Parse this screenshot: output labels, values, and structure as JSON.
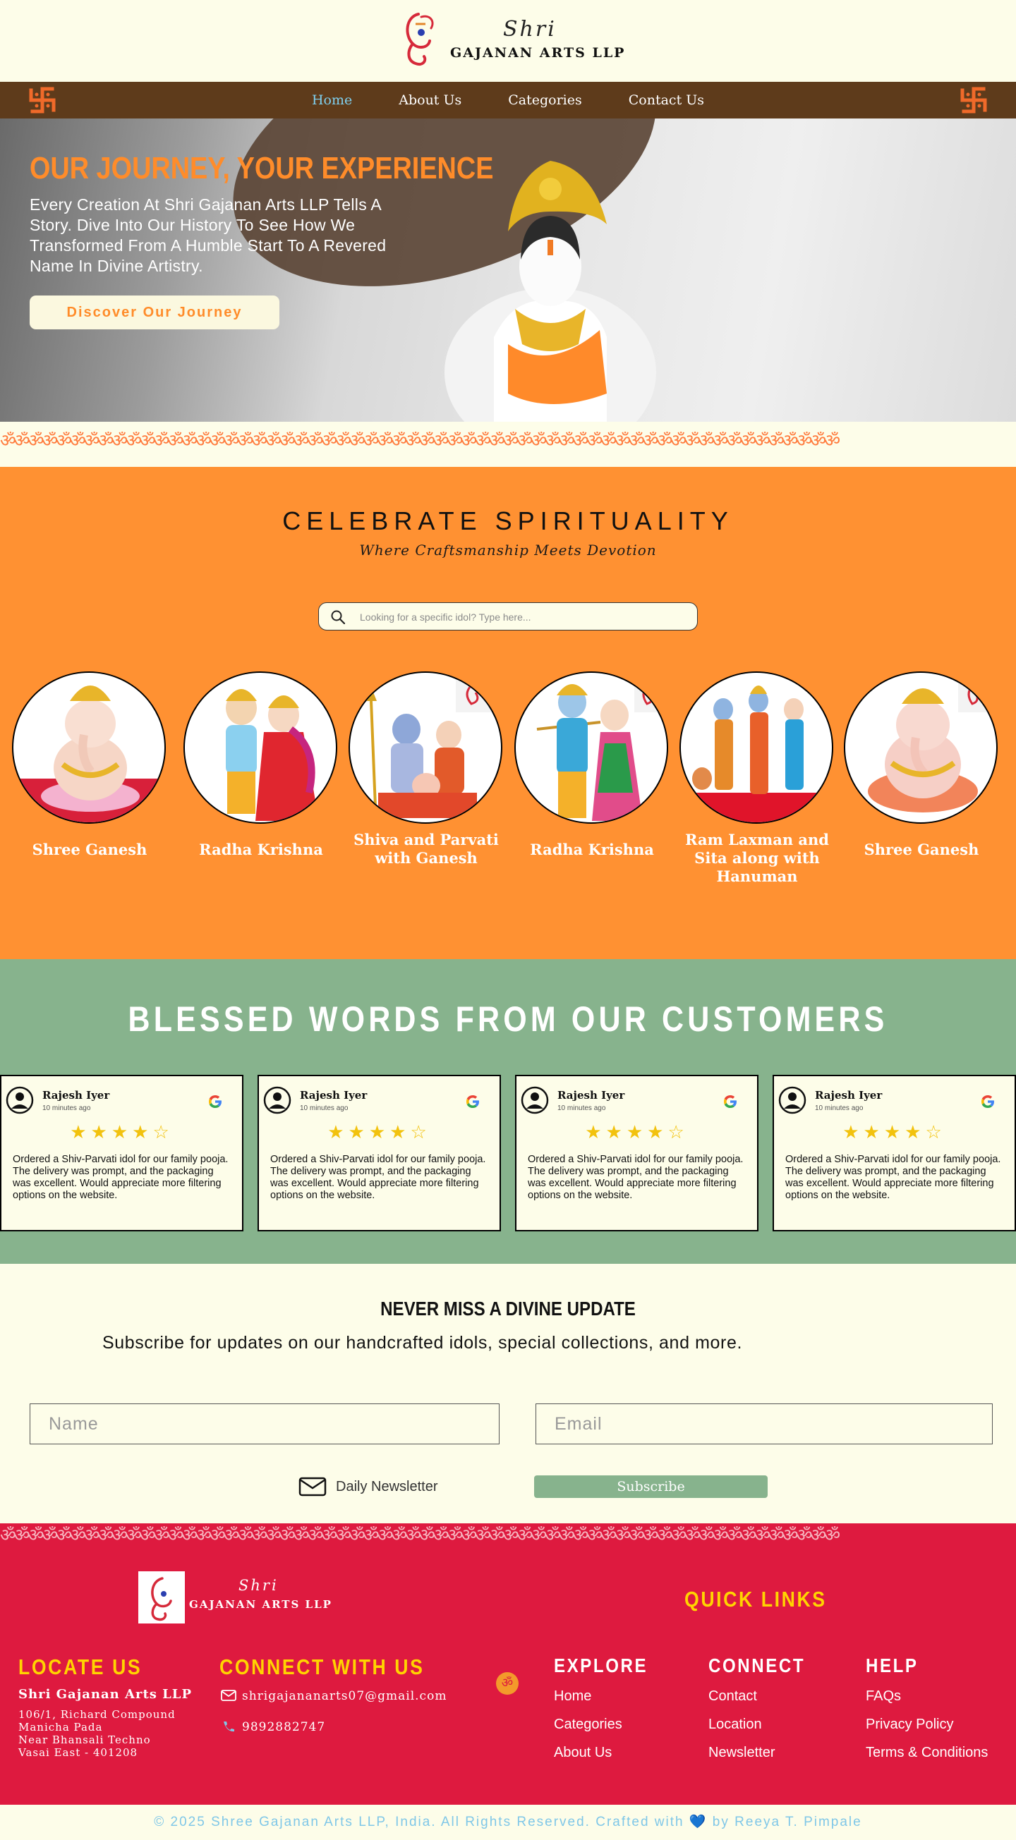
{
  "brand": {
    "shri": "Shri",
    "name": "GAJANAN ARTS LLP"
  },
  "nav": {
    "items": [
      {
        "label": "Home",
        "active": true
      },
      {
        "label": "About Us",
        "active": false
      },
      {
        "label": "Categories",
        "active": false
      },
      {
        "label": "Contact Us",
        "active": false
      }
    ]
  },
  "hero": {
    "title": "OUR JOURNEY, YOUR EXPERIENCE",
    "text": "Every Creation At Shri Gajanan Arts LLP Tells A Story. Dive Into Our History To See How We Transformed From A Humble Start To A Revered Name In Divine Artistry.",
    "button": "Discover Our Journey"
  },
  "om_border": "ॐॐॐॐॐॐॐॐॐॐॐॐॐॐॐॐॐॐॐॐॐॐॐॐॐॐॐॐॐॐॐॐॐॐॐॐॐॐॐॐॐॐॐॐॐॐॐॐॐॐॐॐॐॐॐॐॐॐॐॐ",
  "celebrate": {
    "title": "CELEBRATE SPIRITUALITY",
    "subtitle": "Where Craftsmanship Meets Devotion",
    "search_placeholder": "Looking for a specific idol? Type here...",
    "categories": [
      {
        "label": "Shree Ganesh"
      },
      {
        "label": "Radha Krishna"
      },
      {
        "label": "Shiva and Parvati with Ganesh"
      },
      {
        "label": "Radha Krishna"
      },
      {
        "label": "Ram Laxman and Sita along with Hanuman"
      },
      {
        "label": "Shree Ganesh"
      }
    ]
  },
  "testimonials": {
    "title": "BLESSED WORDS FROM OUR CUSTOMERS",
    "cards": [
      {
        "name": "Rajesh Iyer",
        "time": "10 minutes ago",
        "rating": 4,
        "stars": "★★★★☆",
        "text": "Ordered a Shiv-Parvati idol for our family pooja. The delivery was prompt, and the packaging was excellent. Would appreciate more filtering options on the website."
      },
      {
        "name": "Rajesh Iyer",
        "time": "10 minutes ago",
        "rating": 4,
        "stars": "★★★★☆",
        "text": "Ordered a Shiv-Parvati idol for our family pooja. The delivery was prompt, and the packaging was excellent. Would appreciate more filtering options on the website."
      },
      {
        "name": "Rajesh Iyer",
        "time": "10 minutes ago",
        "rating": 4,
        "stars": "★★★★☆",
        "text": "Ordered a Shiv-Parvati idol for our family pooja. The delivery was prompt, and the packaging was excellent. Would appreciate more filtering options on the website."
      },
      {
        "name": "Rajesh Iyer",
        "time": "10 minutes ago",
        "rating": 4,
        "stars": "★★★★☆",
        "text": "Ordered a Shiv-Parvati idol for our family pooja. The delivery was prompt, and the packaging was excellent. Would appreciate more filtering options on the website."
      }
    ]
  },
  "subscribe": {
    "title": "NEVER MISS A DIVINE UPDATE",
    "text": "Subscribe for updates on our handcrafted idols, special collections, and more.",
    "name_placeholder": "Name",
    "email_placeholder": "Email",
    "newsletter_label": "Daily Newsletter",
    "button": "Subscribe"
  },
  "footer": {
    "shri": "Shri",
    "name": "GAJANAN ARTS LLP",
    "quick_links": "QUICK LINKS",
    "locate": {
      "title": "LOCATE US",
      "company": "Shri Gajanan Arts LLP",
      "address": [
        "106/1, Richard Compound",
        "Manicha Pada",
        "Near Bhansali Techno",
        "Vasai East - 401208"
      ]
    },
    "connect_with_us": {
      "title": "CONNECT WITH US",
      "email": "shrigajananarts07@gmail.com",
      "phone": "9892882747"
    },
    "om_symbol": "ॐ",
    "explore": {
      "title": "EXPLORE",
      "links": [
        "Home",
        "Categories",
        "About Us"
      ]
    },
    "connect": {
      "title": "CONNECT",
      "links": [
        "Contact",
        "Location",
        "Newsletter"
      ]
    },
    "help": {
      "title": "HELP",
      "links": [
        "FAQs",
        "Privacy Policy",
        "Terms & Conditions"
      ]
    }
  },
  "copyright": "© 2025 Shree Gajanan Arts LLP, India. All Rights Reserved. Crafted with 💙 by Reeya T. Pimpale",
  "colors": {
    "nav_bg": "#5e3b1b",
    "accent_orange": "#ff9132",
    "sage_green": "#87b38d",
    "footer_red": "#de1a3f",
    "cream": "#fdfde9",
    "gold_yellow": "#ffd400",
    "active_link": "#7fd0ef"
  },
  "icons": [
    "swastika-icon",
    "search-icon",
    "google-icon",
    "user-avatar-icon",
    "mail-icon",
    "phone-icon",
    "envelope-icon",
    "om-icon"
  ]
}
